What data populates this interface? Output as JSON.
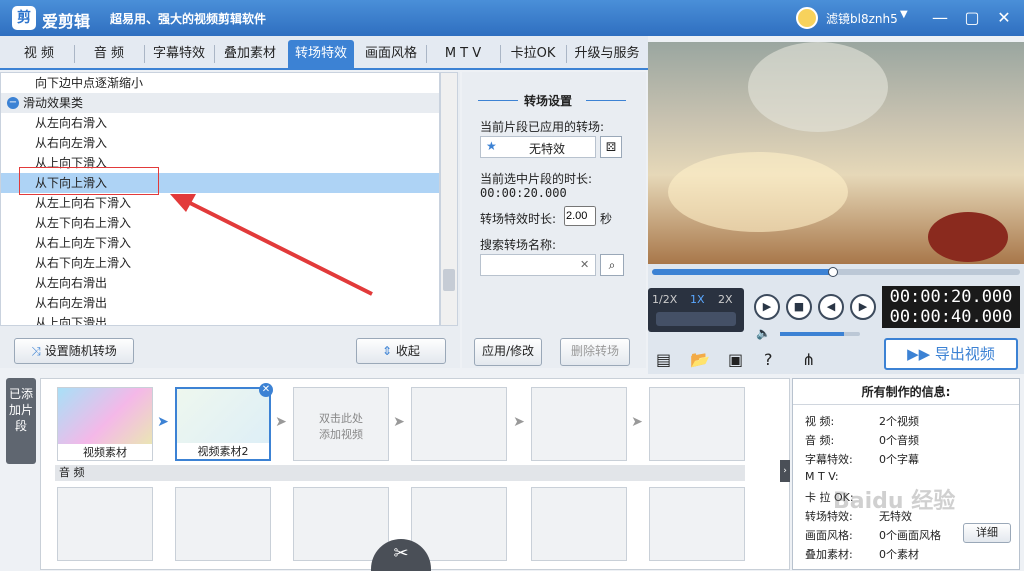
{
  "app": {
    "name": "爱剪辑",
    "slogan": "超易用、强大的视频剪辑软件",
    "user": "滤镜bl8znh5"
  },
  "tabs": [
    "视  频",
    "音  频",
    "字幕特效",
    "叠加素材",
    "转场特效",
    "画面风格",
    "M T V",
    "卡拉OK",
    "升级与服务"
  ],
  "active_tab": "转场特效",
  "transitions": [
    {
      "label": "向下边中点逐渐缩小",
      "type": "item"
    },
    {
      "label": "滑动效果类",
      "type": "group"
    },
    {
      "label": "从左向右滑入",
      "type": "item"
    },
    {
      "label": "从右向左滑入",
      "type": "item"
    },
    {
      "label": "从上向下滑入",
      "type": "item"
    },
    {
      "label": "从下向上滑入",
      "type": "item",
      "selected": true
    },
    {
      "label": "从左上向右下滑入",
      "type": "item"
    },
    {
      "label": "从左下向右上滑入",
      "type": "item"
    },
    {
      "label": "从右上向左下滑入",
      "type": "item"
    },
    {
      "label": "从右下向左上滑入",
      "type": "item"
    },
    {
      "label": "从左向右滑出",
      "type": "item"
    },
    {
      "label": "从右向左滑出",
      "type": "item"
    },
    {
      "label": "从上向下滑出",
      "type": "item"
    }
  ],
  "left_buttons": {
    "random": "设置随机转场",
    "apply": "收起"
  },
  "settings": {
    "title": "转场设置",
    "applied_label": "当前片段已应用的转场:",
    "applied_value": "无特效",
    "duration_label": "当前选中片段的时长:",
    "duration_value": "00:00:20.000",
    "effect_duration_label": "转场特效时长:",
    "effect_duration_value": "2.00",
    "unit": "秒",
    "search_label": "搜索转场名称:",
    "search_placeholder": "",
    "apply_button": "应用/修改",
    "delete_button": "删除转场"
  },
  "player": {
    "speeds": [
      "1/2X",
      "1X",
      "2X"
    ],
    "active_speed": "1X",
    "time_current": "00:00:20.000",
    "time_total": "00:00:40.000",
    "progress": 0.5,
    "volume": 0.8
  },
  "export_label": "导出视频",
  "clips": {
    "tag": "已添加片段",
    "items": [
      "视频素材",
      "视频素材2"
    ],
    "placeholder": "双击此处\n添加视频",
    "audio_label": "音 频"
  },
  "info": {
    "title": "所有制作的信息:",
    "rows": [
      {
        "k": "视    频:",
        "v": "2个视频"
      },
      {
        "k": "音    频:",
        "v": "0个音频"
      },
      {
        "k": "字幕特效:",
        "v": "0个字幕"
      },
      {
        "k": "M  T  V:",
        "v": ""
      },
      {
        "k": "卡 拉 OK:",
        "v": ""
      },
      {
        "k": "转场特效:",
        "v": "无特效"
      },
      {
        "k": "画面风格:",
        "v": "0个画面风格"
      },
      {
        "k": "叠加素材:",
        "v": "0个素材"
      }
    ],
    "detail_button": "详细"
  },
  "watermark": "Baidu 经验",
  "colors": {
    "accent": "#3c82d4",
    "selected_row": "#aed3f5",
    "annotation": "#e23a3a"
  }
}
